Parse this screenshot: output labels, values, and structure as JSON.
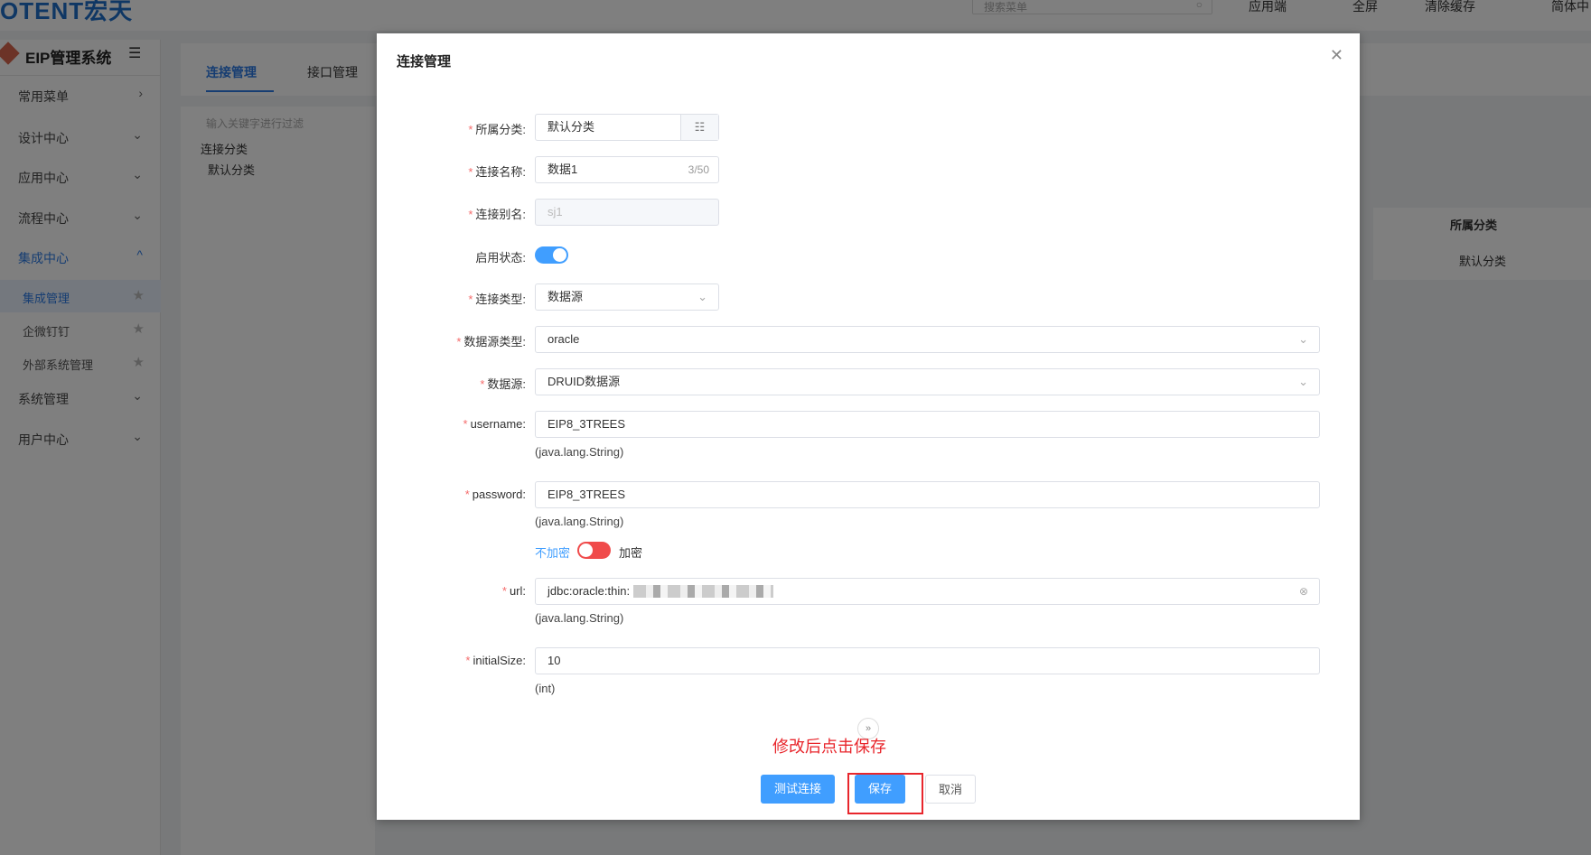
{
  "topbar": {
    "logo": "OTENT宏天",
    "search_placeholder": "搜索菜单",
    "items": [
      "应用端",
      "全屏",
      "清除缓存",
      "简体中"
    ]
  },
  "sidebar": {
    "title": "EIP管理系统",
    "menus": [
      {
        "label": "常用菜单"
      },
      {
        "label": "设计中心"
      },
      {
        "label": "应用中心"
      },
      {
        "label": "流程中心"
      },
      {
        "label": "集成中心"
      },
      {
        "label": "系统管理"
      },
      {
        "label": "用户中心"
      }
    ],
    "submenu": [
      "集成管理",
      "企微钉钉",
      "外部系统管理"
    ]
  },
  "tabs": [
    "连接管理",
    "接口管理"
  ],
  "tree": {
    "filter_placeholder": "输入关键字进行过滤",
    "root": "连接分类",
    "child": "默认分类"
  },
  "table": {
    "header": "所属分类",
    "cell": "默认分类"
  },
  "modal": {
    "title": "连接管理",
    "fields": {
      "category": {
        "label": "所属分类:",
        "value": "默认分类"
      },
      "name": {
        "label": "连接名称:",
        "value": "数据1",
        "count": "3/50"
      },
      "alias": {
        "label": "连接别名:",
        "value": "sj1"
      },
      "enabled": {
        "label": "启用状态:",
        "on": true
      },
      "type": {
        "label": "连接类型:",
        "value": "数据源"
      },
      "dstype": {
        "label": "数据源类型:",
        "value": "oracle"
      },
      "ds": {
        "label": "数据源:",
        "value": "DRUID数据源"
      },
      "username": {
        "label": "username:",
        "value": "EIP8_3TREES",
        "hint": "(java.lang.String)"
      },
      "password": {
        "label": "password:",
        "value": "EIP8_3TREES",
        "hint": "(java.lang.String)",
        "no_encrypt": "不加密",
        "encrypt": "加密"
      },
      "url": {
        "label": "url:",
        "value": "jdbc:oracle:thin:",
        "hint": "(java.lang.String)"
      },
      "initialSize": {
        "label": "initialSize:",
        "value": "10",
        "hint": "(int)"
      }
    },
    "annotation": "修改后点击保存",
    "buttons": {
      "test": "测试连接",
      "save": "保存",
      "cancel": "取消"
    }
  }
}
